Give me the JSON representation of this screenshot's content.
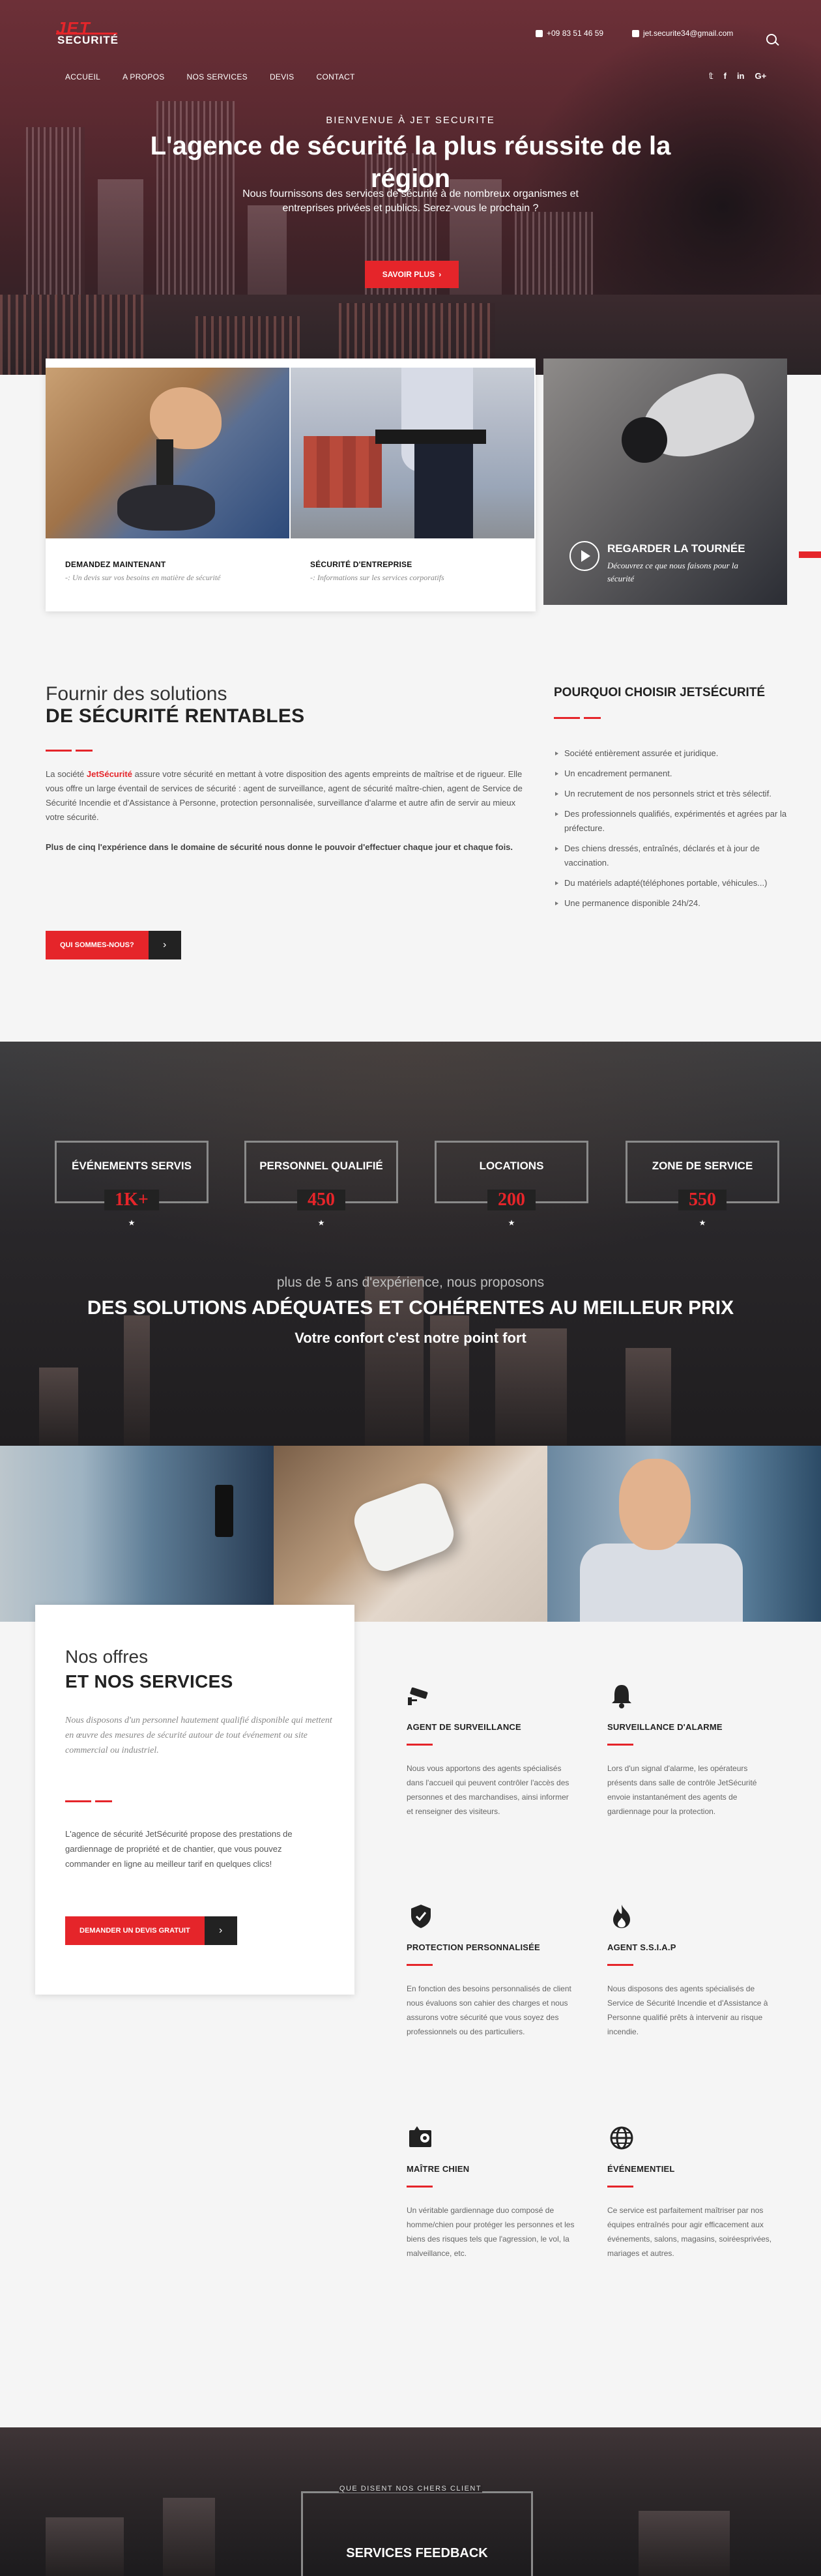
{
  "header": {
    "logo": {
      "top": "JET",
      "bottom": "SECURITÉ"
    },
    "phone": "+09 83 51 46 59",
    "email": "jet.securite34@gmail.com",
    "nav": [
      "ACCUEIL",
      "A PROPOS",
      "NOS SERVICES",
      "DEVIS",
      "CONTACT"
    ],
    "social": [
      "twitter-icon",
      "facebook-icon",
      "linkedin-icon",
      "googleplus-icon"
    ],
    "social_glyphs": {
      "twitter": "𝕥",
      "facebook": "f",
      "linkedin": "in",
      "googleplus": "G+"
    }
  },
  "hero": {
    "kicker": "BIENVENUE À JET SECURITE",
    "title": "L'agence de sécurité la plus réussite de la région",
    "subtitle": "Nous fournissons des services de sécurité à de nombreux organismes et entreprises privées et publics. Serez-vous le prochain ?",
    "button": "SAVOIR PLUS"
  },
  "cards": [
    {
      "title": "DEMANDEZ MAINTENANT",
      "desc": "-: Un devis sur vos besoins en matière de sécurité"
    },
    {
      "title": "SÉCURITÉ D'ENTREPRISE",
      "desc": "-: Informations sur les services corporatifs"
    }
  ],
  "video": {
    "title": "REGARDER LA TOURNÉE",
    "desc": "Découvrez ce que nous faisons pour la sécurité"
  },
  "about": {
    "heading_light": "Fournir des solutions",
    "heading_bold": "DE SÉCURITÉ RENTABLES",
    "p1_pre": "La société ",
    "p1_brand": "JetSécurité",
    "p1_post": " assure votre sécurité en mettant à votre disposition des agents empreints de maîtrise et de rigueur. Elle vous offre un large éventail de services de sécurité : agent de surveillance, agent de sécurité maître-chien, agent de Service de Sécurité Incendie et d'Assistance à Personne, protection personnalisée, surveillance d'alarme et autre afin de servir au mieux votre sécurité.",
    "p2": "Plus de cinq l'expérience dans le domaine de sécurité nous donne le pouvoir d'effectuer chaque jour et chaque fois.",
    "button": "QUI SOMMES-NOUS?",
    "button_arrow": "›"
  },
  "why": {
    "title": "POURQUOI CHOISIR JETSÉCURITÉ",
    "items": [
      "Société entièrement assurée et juridique.",
      "Un encadrement permanent.",
      "Un recrutement de nos personnels strict et très sélectif.",
      "Des professionnels qualifiés, expérimentés et agrées par la préfecture.",
      "Des chiens dressés, entraînés, déclarés et à jour de vaccination.",
      "Du matériels adapté(téléphones portable, véhicules...)",
      "Une permanence disponible 24h/24."
    ]
  },
  "stats": {
    "items": [
      {
        "label": "ÉVÉNEMENTS SERVIS",
        "value": "1K+"
      },
      {
        "label": "PERSONNEL QUALIFIÉ",
        "value": "450"
      },
      {
        "label": "LOCATIONS",
        "value": "200"
      },
      {
        "label": "ZONE DE SERVICE",
        "value": "550"
      }
    ],
    "star": "★",
    "line1": "plus de 5 ans d'expérience, nous proposons",
    "line2": "DES SOLUTIONS ADÉQUATES ET COHÉRENTES AU MEILLEUR PRIX",
    "line3": "Votre confort c'est notre point fort"
  },
  "offers": {
    "heading_light": "Nos offres",
    "heading_bold": "ET NOS SERVICES",
    "intro": "Nous disposons d'un personnel hautement qualifié disponible qui mettent en œuvre des mesures de sécurité autour de tout événement ou site commercial ou industriel.",
    "text": "L'agence de sécurité JetSécurité propose des prestations de gardiennage de propriété et de chantier, que vous pouvez commander en ligne au meilleur tarif en quelques clics!",
    "button": "DEMANDER UN DEVIS GRATUIT",
    "button_arrow": "›"
  },
  "services": [
    {
      "icon": "cctv-camera-icon",
      "title": "AGENT DE SURVEILLANCE",
      "desc": "Nous vous apportons des agents spécialisés dans l'accueil qui peuvent contrôler l'accès des personnes et des marchandises, ainsi informer et renseigner des visiteurs."
    },
    {
      "icon": "alarm-bell-icon",
      "title": "SURVEILLANCE D'ALARME",
      "desc": "Lors d'un signal d'alarme, les opérateurs présents dans salle de contrôle JetSécurité envoie instantanément des agents de gardiennage pour la protection."
    },
    {
      "icon": "shield-icon",
      "title": "PROTECTION PERSONNALISÉE",
      "desc": "En fonction des besoins personnalisés de client nous évaluons son cahier des charges et nous assurons votre sécurité que vous soyez des professionnels ou des particuliers."
    },
    {
      "icon": "fire-icon",
      "title": "AGENT S.S.I.A.P",
      "desc": "Nous disposons des agents spécialisés de Service de Sécurité Incendie et d'Assistance à Personne qualifié prêts à intervenir au risque incendie."
    },
    {
      "icon": "dog-icon",
      "title": "MAÎTRE CHIEN",
      "desc": "Un véritable gardiennage duo composé de homme/chien pour protéger les personnes et les biens des risques tels que l'agression, le vol, la malveillance, etc."
    },
    {
      "icon": "globe-icon",
      "title": "ÉVÉNEMENTIEL",
      "desc": "Ce service est parfaitement maîtriser par nos équipes entraînés pour agir efficacement aux événements, salons, magasins, soiréesprivées, mariages et autres."
    }
  ],
  "feedback": {
    "kicker": "QUE DISENT NOS CHERS CLIENT",
    "title": "SERVICES FEEDBACK"
  },
  "colors": {
    "accent": "#e5252a",
    "dark": "#222222"
  }
}
